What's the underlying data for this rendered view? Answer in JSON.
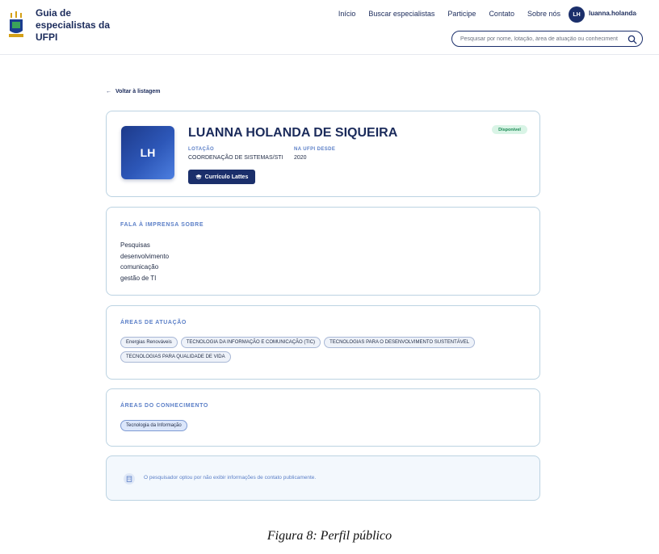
{
  "header": {
    "brand": "Guia de especialistas da UFPI",
    "nav": [
      "Início",
      "Buscar especialistas",
      "Participe",
      "Contato",
      "Sobre nós"
    ],
    "user_initials": "LH",
    "username": "luanna.holanda",
    "search_placeholder": "Pesquisar por nome, lotação, área de atuação ou conhecimento"
  },
  "back_label": "Voltar à listagem",
  "profile": {
    "initials": "LH",
    "name": "LUANNA HOLANDA DE SIQUEIRA",
    "lotacao_label": "LOTAÇÃO",
    "lotacao": "COORDENAÇÃO DE SISTEMAS/STI",
    "desde_label": "NA UFPI DESDE",
    "desde": "2020",
    "lattes_label": "Currículo Lattes",
    "status": "Disponível",
    "status_color": "#1a8a53"
  },
  "press": {
    "title": "FALA À IMPRENSA SOBRE",
    "items": [
      "Pesquisas",
      "desenvolvimento",
      "comunicação",
      "gestão de TI"
    ]
  },
  "areas": {
    "title": "ÁREAS DE ATUAÇÃO",
    "chips": [
      "Energias Renováveis",
      "TECNOLOGIA DA INFORMAÇÃO E COMUNICAÇÃO (TIC)",
      "TECNOLOGIAS PARA O DESENVOLVIMENTO SUSTENTÁVEL",
      "TECNOLOGIAS PARA QUALIDADE DE VIDA"
    ]
  },
  "conhecimento": {
    "title": "ÁREAS DO CONHECIMENTO",
    "chips": [
      "Tecnologia da Informação"
    ]
  },
  "contact_notice": "O pesquisador optou por não exibir informações de contato publicamente.",
  "caption": "Figura 8: Perfil público"
}
